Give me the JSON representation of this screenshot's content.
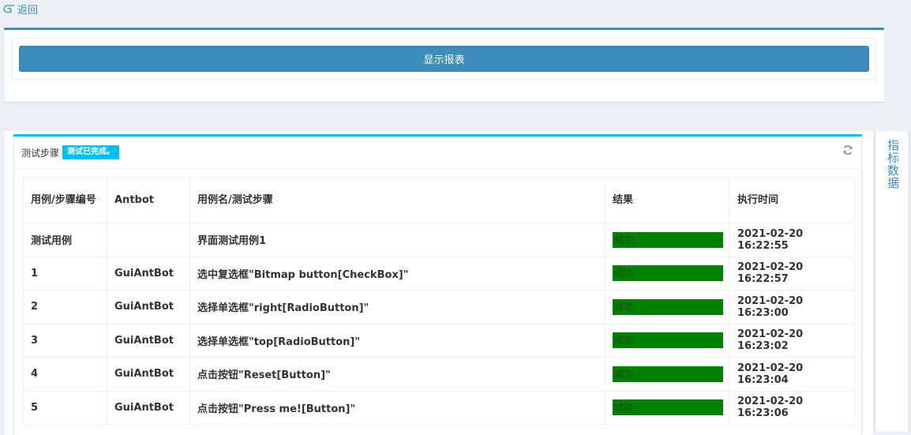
{
  "nav": {
    "back_label": "返回"
  },
  "report": {
    "button_label": "显示报表"
  },
  "steps_panel": {
    "title": "测试步骤",
    "status_badge": "测试已完成。",
    "columns": [
      "用例/步骤编号",
      "Antbot",
      "用例名/测试步骤",
      "结果",
      "执行时间"
    ],
    "rows": [
      {
        "id": "测试用例",
        "antbot": "",
        "step": "界面测试用例1",
        "result": "成功",
        "time": "2021-02-20 16:22:55"
      },
      {
        "id": "1",
        "antbot": "GuiAntBot",
        "step": "选中复选框\"Bitmap button[CheckBox]\"",
        "result": "成功",
        "time": "2021-02-20 16:22:57"
      },
      {
        "id": "2",
        "antbot": "GuiAntBot",
        "step": "选择单选框\"right[RadioButton]\"",
        "result": "成功",
        "time": "2021-02-20 16:23:00"
      },
      {
        "id": "3",
        "antbot": "GuiAntBot",
        "step": "选择单选框\"top[RadioButton]\"",
        "result": "成功",
        "time": "2021-02-20 16:23:02"
      },
      {
        "id": "4",
        "antbot": "GuiAntBot",
        "step": "点击按钮\"Reset[Button]\"",
        "result": "成功",
        "time": "2021-02-20 16:23:04"
      },
      {
        "id": "5",
        "antbot": "GuiAntBot",
        "step": "点击按钮\"Press me![Button]\"",
        "result": "成功",
        "time": "2021-02-20 16:23:06"
      }
    ]
  },
  "side_tab": {
    "label": "指标数据"
  },
  "colors": {
    "primary": "#3c8dbc",
    "info": "#00c0ef",
    "success_bar": "#008000",
    "page_bg": "#ecf0f5"
  }
}
